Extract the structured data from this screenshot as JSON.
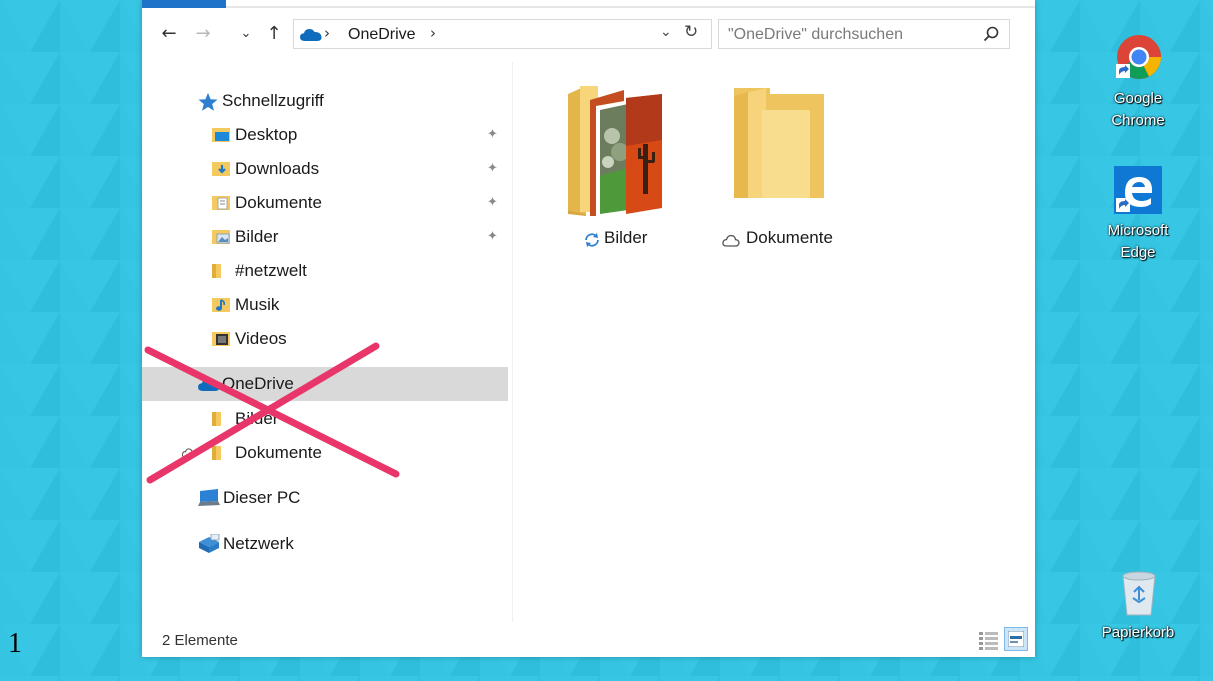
{
  "explorer": {
    "nav": {
      "back": "←",
      "forward": "→",
      "recent": "⌄",
      "up": "↑"
    },
    "address": {
      "separator": "›",
      "path": "OneDrive",
      "dropdown": "⌄",
      "refresh": "↻"
    },
    "search": {
      "placeholder": "\"OneDrive\" durchsuchen"
    },
    "sidebar": {
      "quick_access": "Schnellzugriff",
      "items": [
        {
          "label": "Desktop",
          "pinned": true
        },
        {
          "label": "Downloads",
          "pinned": true
        },
        {
          "label": "Dokumente",
          "pinned": true
        },
        {
          "label": "Bilder",
          "pinned": true
        },
        {
          "label": "#netzwelt",
          "pinned": false
        },
        {
          "label": "Musik",
          "pinned": false
        },
        {
          "label": "Videos",
          "pinned": false
        }
      ],
      "onedrive": "OneDrive",
      "onedrive_children": [
        "Bilder",
        "Dokumente"
      ],
      "this_pc": "Dieser PC",
      "network": "Netzwerk",
      "pin_glyph": "✦"
    },
    "content": {
      "folders": [
        {
          "label": "Bilder",
          "status_icon": "sync-icon",
          "has_preview": true
        },
        {
          "label": "Dokumente",
          "status_icon": "cloud-icon",
          "has_preview": false
        }
      ]
    },
    "status": {
      "count": "2 Elemente"
    }
  },
  "desktop": {
    "icons": [
      {
        "label_line1": "Google",
        "label_line2": "Chrome"
      },
      {
        "label_line1": "Microsoft",
        "label_line2": "Edge"
      },
      {
        "label_line1": "Papierkorb",
        "label_line2": ""
      }
    ]
  },
  "page_number": "1",
  "colors": {
    "desktop": "#36c6e3",
    "accent": "#1f73c9",
    "selection": "#d9d9d9",
    "cross": "#e8356a",
    "folder": "#f7d57a"
  }
}
